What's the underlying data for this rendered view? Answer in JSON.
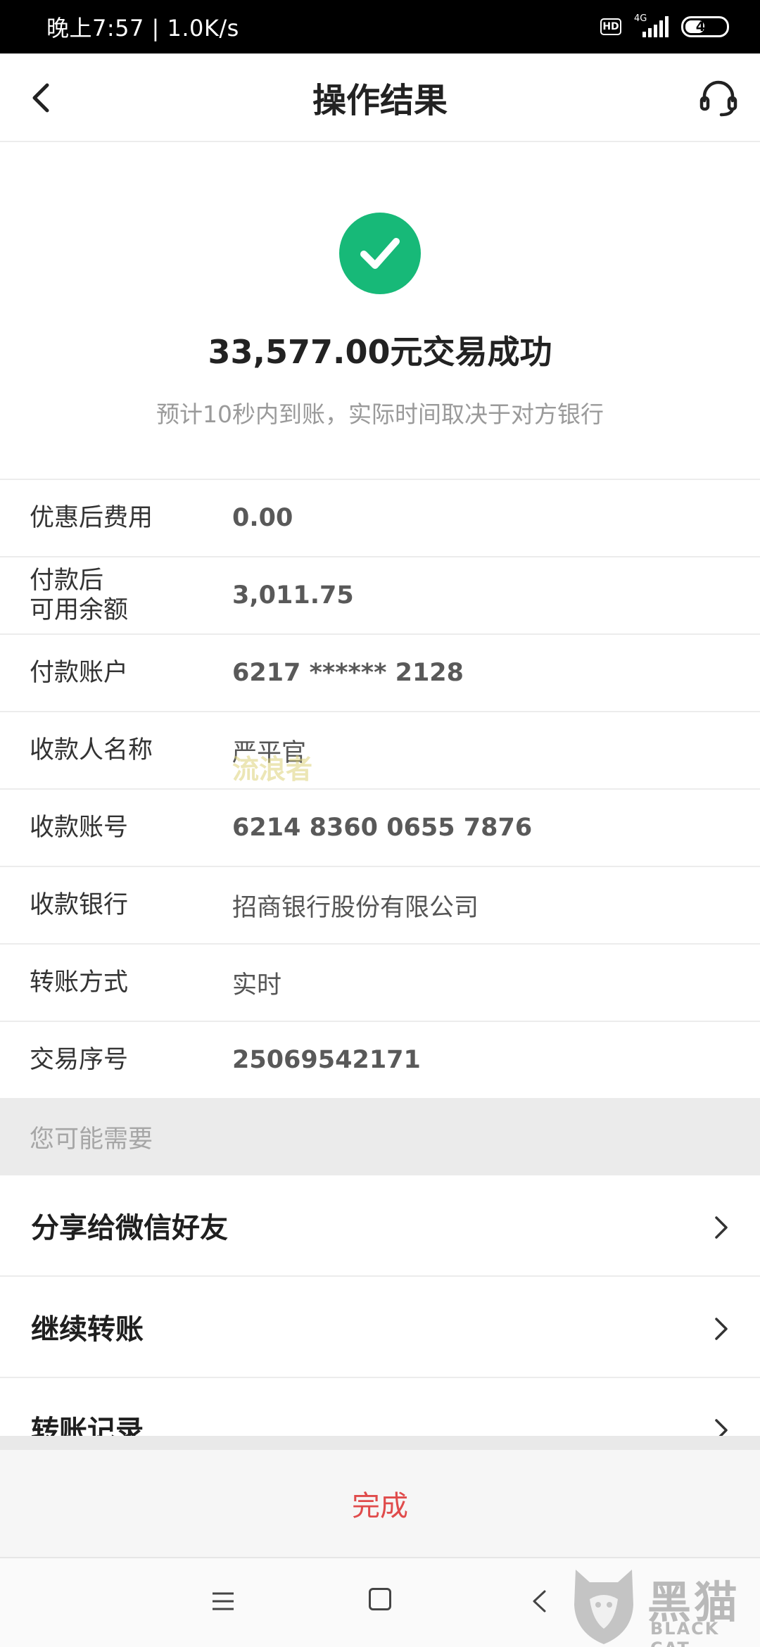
{
  "status_bar": {
    "time": "晚上7:57 | 1.0K/s",
    "hd": "HD",
    "network": "4G",
    "battery": "47"
  },
  "header": {
    "title": "操作结果",
    "back_icon": "chevron-left-icon",
    "service_icon": "headset-icon"
  },
  "result": {
    "icon": "check-circle-icon",
    "icon_color": "#17b978",
    "amount_text": "33,577.00元交易成功",
    "note": "预计10秒内到账，实际时间取决于对方银行"
  },
  "details": [
    {
      "label": "优惠后费用",
      "value": "0.00"
    },
    {
      "label": "付款后\n可用余额",
      "value": "3,011.75"
    },
    {
      "label": "付款账户",
      "value": "6217 ****** 2128"
    },
    {
      "label": "收款人名称",
      "value": "严平官"
    },
    {
      "label": "收款账号",
      "value": "6214 8360 0655 7876"
    },
    {
      "label": "收款银行",
      "value": "招商银行股份有限公司"
    },
    {
      "label": "转账方式",
      "value": "实时"
    },
    {
      "label": "交易序号",
      "value": "25069542171"
    }
  ],
  "watermark": "流浪者",
  "suggestions": {
    "title": "您可能需要",
    "items": [
      {
        "label": "分享给微信好友"
      },
      {
        "label": "继续转账"
      },
      {
        "label": "转账记录"
      }
    ]
  },
  "done_button": {
    "label": "完成",
    "color": "#e04b4b"
  },
  "nav_bar": {
    "menu_icon": "menu-icon",
    "home_icon": "home-square-icon",
    "back_icon": "back-triangle-icon"
  },
  "logo": {
    "text": "黑猫",
    "subtext": "BLACK CAT"
  }
}
